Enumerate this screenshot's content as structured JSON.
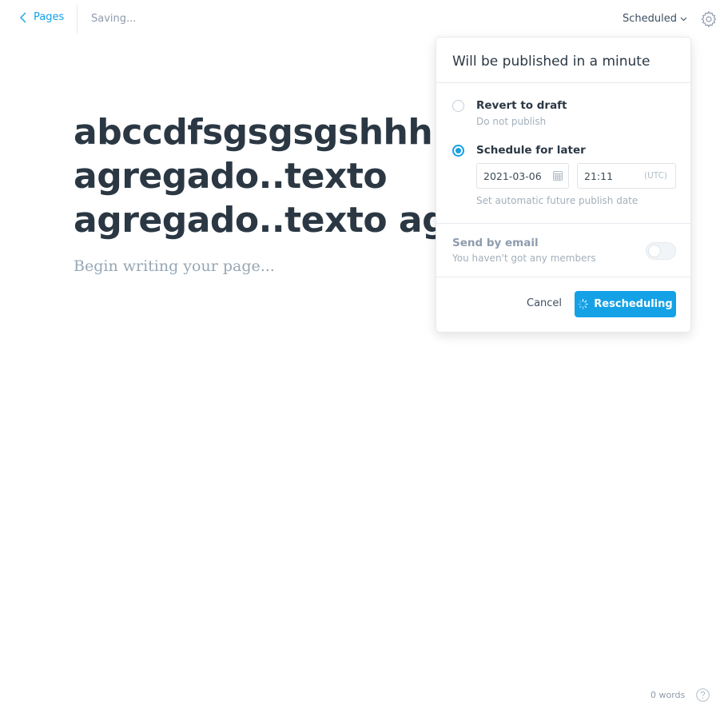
{
  "header": {
    "back_label": "Pages",
    "saving_status": "Saving...",
    "status_label": "Scheduled"
  },
  "editor": {
    "title_lines": [
      "abccdfsgsgsgshhh..texto",
      "agregado..texto",
      "agregado..texto agregado"
    ],
    "body_placeholder": "Begin writing your page..."
  },
  "publish_menu": {
    "title": "Will be published in a minute",
    "revert_option": {
      "label": "Revert to draft",
      "description": "Do not publish",
      "selected": false
    },
    "schedule_option": {
      "label": "Schedule for later",
      "selected": true,
      "description": "Set automatic future publish date"
    },
    "date_value": "2021-03-06",
    "time_value": "21:11",
    "timezone": "(UTC)",
    "email": {
      "label": "Send by email",
      "description": "You haven't got any members",
      "enabled": false
    },
    "cancel_label": "Cancel",
    "confirm_label": "Rescheduling"
  },
  "footer": {
    "word_count": "0 words"
  },
  "colors": {
    "accent": "#14a1e6",
    "title_text": "#2b3844",
    "muted": "#8e9cac"
  }
}
